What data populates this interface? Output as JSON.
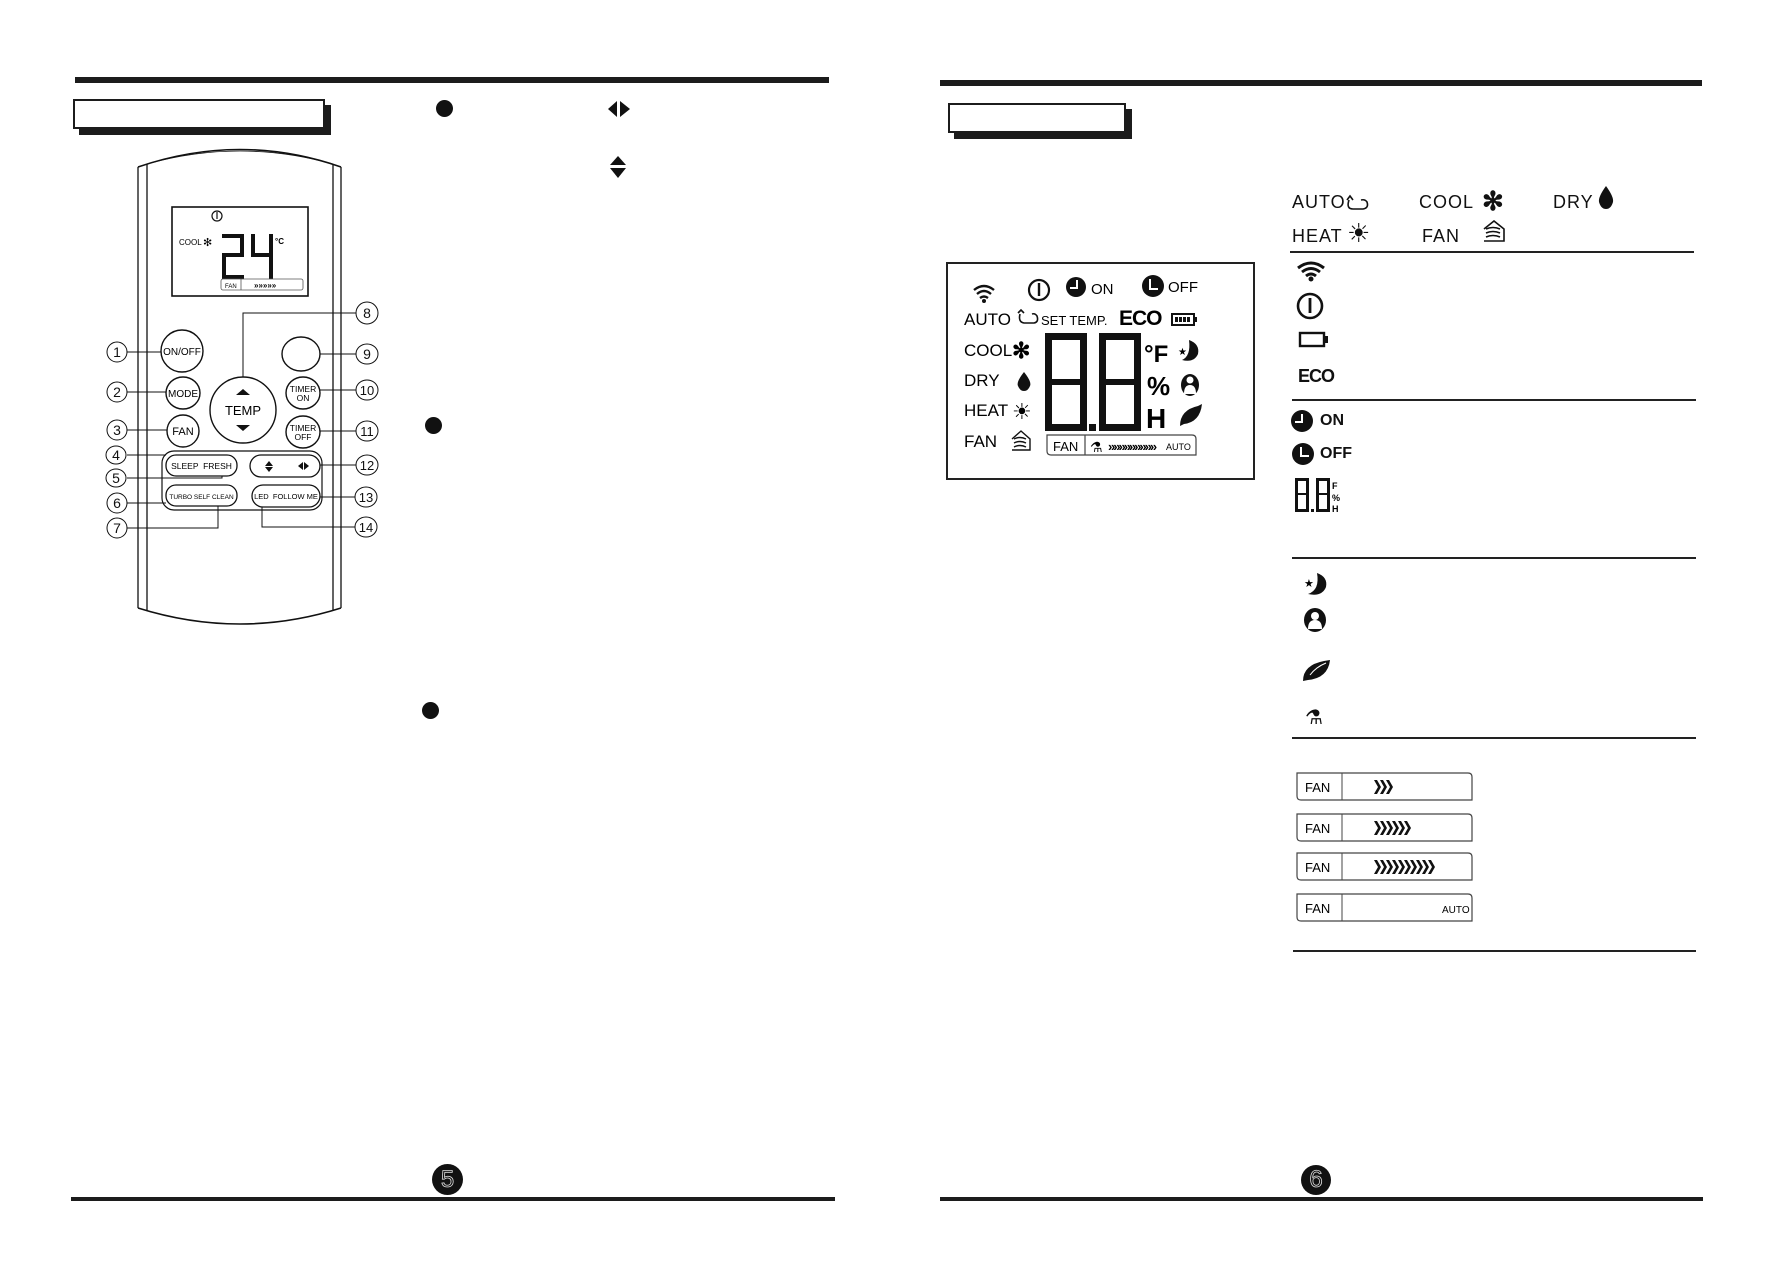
{
  "left_page": {
    "page_number": "5",
    "section_title": "",
    "remote": {
      "lcd": {
        "mode_label": "COOL",
        "mode_icon": "snowflake-icon",
        "power_icon": "power-icon",
        "temperature": "24",
        "unit": "°C",
        "fan_label": "FAN",
        "fan_speed_arrows": "»»»»»"
      },
      "buttons": [
        {
          "id": 1,
          "label": "ON/OFF"
        },
        {
          "id": 2,
          "label": "MODE"
        },
        {
          "id": 3,
          "label": "FAN"
        },
        {
          "id": 4,
          "label": "SLEEP"
        },
        {
          "id": 5,
          "label": "FRESH"
        },
        {
          "id": 6,
          "label": "TURBO"
        },
        {
          "id": 7,
          "label": "SELF CLEAN"
        },
        {
          "id": 8,
          "label": "TEMP"
        },
        {
          "id": 9,
          "label": ""
        },
        {
          "id": 10,
          "label_line1": "TIMER",
          "label_line2": "ON"
        },
        {
          "id": 11,
          "label_line1": "TIMER",
          "label_line2": "OFF"
        },
        {
          "id": 12,
          "label": "swing (up-down / left-right)"
        },
        {
          "id": 13,
          "label": "LED"
        },
        {
          "id": 14,
          "label": "FOLLOW ME"
        }
      ],
      "pill_labels": {
        "sleep_fresh": "SLEEP  FRESH",
        "turbo_selfclean": "TURBO SELF CLEAN",
        "led_followme": "LED  FOLLOW ME"
      },
      "callouts": [
        "1",
        "2",
        "3",
        "4",
        "5",
        "6",
        "7",
        "8",
        "9",
        "10",
        "11",
        "12",
        "13",
        "14"
      ]
    },
    "icons": [
      "bullet",
      "left-right-swing-icon",
      "up-down-swing-icon",
      "bullet",
      "bullet"
    ]
  },
  "right_page": {
    "page_number": "6",
    "section_title": "",
    "lcd_panel": {
      "top_row": {
        "on": "ON",
        "off": "OFF"
      },
      "modes": [
        "AUTO",
        "COOL",
        "DRY",
        "HEAT",
        "FAN"
      ],
      "set_temp": "SET TEMP.",
      "eco": "ECO",
      "digits": "8.8",
      "unit_f": "°F",
      "percent": "%",
      "h": "H",
      "fan_label": "FAN",
      "fan_arrows": "»»»»»»»»»",
      "auto": "AUTO"
    },
    "legend": {
      "modes_row1": [
        {
          "label": "AUTO",
          "icon": "auto-cycle-icon"
        },
        {
          "label": "COOL",
          "icon": "snowflake-icon"
        },
        {
          "label": "DRY",
          "icon": "droplet-icon"
        }
      ],
      "modes_row2": [
        {
          "label": "HEAT",
          "icon": "sun-icon"
        },
        {
          "label": "FAN",
          "icon": "house-fan-icon"
        }
      ],
      "status_icons": [
        "wifi-icon",
        "power-icon",
        "battery-icon",
        "eco-icon"
      ],
      "eco_text": "ECO",
      "timer": [
        {
          "label": "ON",
          "icon": "clock-icon"
        },
        {
          "label": "OFF",
          "icon": "clock-icon"
        }
      ],
      "digit_display": "8.8",
      "digit_units": [
        "°F",
        "%",
        "H"
      ],
      "function_icons": [
        "sleep-moon-icon",
        "follow-me-person-icon",
        "fresh-leaf-icon",
        "self-clean-icon"
      ],
      "fan_speeds": [
        {
          "label": "FAN",
          "level": "low",
          "arrows": 3,
          "text": ""
        },
        {
          "label": "FAN",
          "level": "medium",
          "arrows": 6,
          "text": ""
        },
        {
          "label": "FAN",
          "level": "high",
          "arrows": 10,
          "text": ""
        },
        {
          "label": "FAN",
          "level": "auto",
          "arrows": 0,
          "text": "AUTO"
        }
      ]
    }
  },
  "colors": {
    "ink": "#1c1c1c",
    "paper": "#ffffff",
    "watermark": "#3b4fff"
  }
}
